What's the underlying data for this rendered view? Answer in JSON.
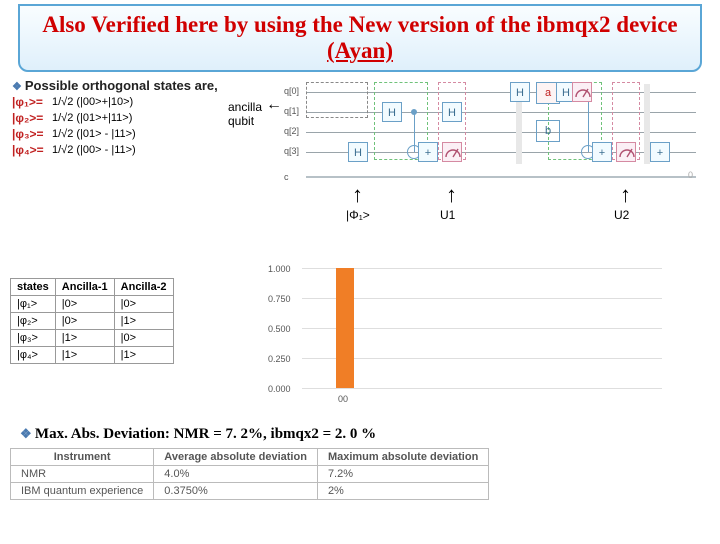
{
  "title": {
    "line": "Also Verified here by using the New version of the ibmqx2 device (Ayan)"
  },
  "orthogonal": {
    "header": "Possible orthogonal states are,",
    "rows": [
      {
        "psi": "|φ₁>=",
        "eq": "1/√2 (|00>+|10>)"
      },
      {
        "psi": "|φ₂>=",
        "eq": "1/√2 (|01>+|11>)"
      },
      {
        "psi": "|φ₃>=",
        "eq": "1/√2 (|01> - |11>)"
      },
      {
        "psi": "|φ₄>=",
        "eq": "1/√2 (|00> - |11>)"
      }
    ]
  },
  "ancilla_label": "ancilla qubit",
  "qubits": [
    "q[0]",
    "q[1]",
    "q[2]",
    "q[3]",
    "c"
  ],
  "gates": {
    "H": "H",
    "plus": "+"
  },
  "ab": {
    "a": "a",
    "b": "b"
  },
  "circuit_labels": {
    "phi": "|Φ₁>",
    "u1": "U1",
    "u2": "U2"
  },
  "states_table": {
    "header": [
      "states",
      "Ancilla-1",
      "Ancilla-2"
    ],
    "rows": [
      [
        "|φ₁>",
        "|0>",
        "|0>"
      ],
      [
        "|φ₂>",
        "|0>",
        "|1>"
      ],
      [
        "|φ₃>",
        "|1>",
        "|0>"
      ],
      [
        "|φ₄>",
        "|1>",
        "|1>"
      ]
    ]
  },
  "chart_data": {
    "type": "bar",
    "categories": [
      "00"
    ],
    "values": [
      1.0
    ],
    "title": "",
    "xlabel": "",
    "ylabel": "",
    "ylim": [
      0,
      1.0
    ],
    "yticks": [
      "0.000",
      "0.250",
      "0.500",
      "0.750",
      "1.000"
    ]
  },
  "deviation_text": "Max. Abs. Deviation:  NMR = 7. 2%, ibmqx2 = 2. 0 %",
  "dev_table": {
    "header": [
      "Instrument",
      "Average absolute deviation",
      "Maximum absolute deviation"
    ],
    "rows": [
      [
        "NMR",
        "4.0%",
        "7.2%"
      ],
      [
        "IBM quantum experience",
        "0.3750%",
        "2%"
      ]
    ]
  }
}
